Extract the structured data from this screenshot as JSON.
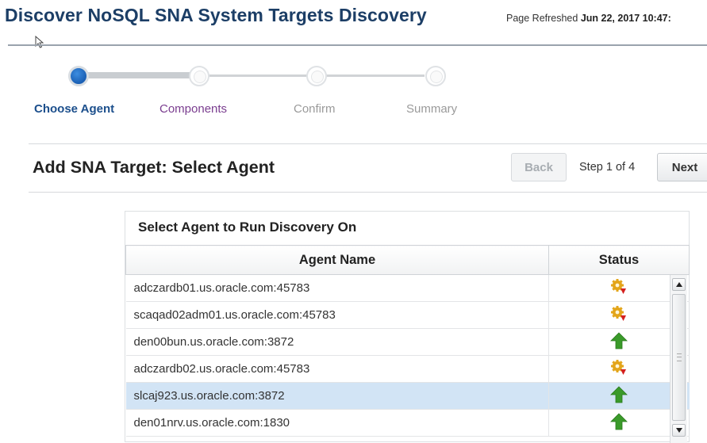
{
  "header": {
    "title": "Discover NoSQL SNA System Targets Discovery",
    "refreshed_label": "Page Refreshed",
    "refreshed_value": "Jun 22, 2017 10:47:"
  },
  "train": {
    "steps": [
      {
        "label": "Choose Agent",
        "state": "current"
      },
      {
        "label": "Components",
        "state": "visited"
      },
      {
        "label": "Confirm",
        "state": "unvisited"
      },
      {
        "label": "Summary",
        "state": "unvisited"
      }
    ]
  },
  "toolbar": {
    "title": "Add SNA Target: Select Agent",
    "back_label": "Back",
    "step_text": "Step 1 of 4",
    "next_label": "Next"
  },
  "agent_panel": {
    "title": "Select Agent to Run Discovery On",
    "columns": [
      "Agent Name",
      "Status"
    ],
    "rows": [
      {
        "name": "adczardb01.us.oracle.com:45783",
        "status": "status-pending-icon"
      },
      {
        "name": "scaqad02adm01.us.oracle.com:45783",
        "status": "status-pending-icon"
      },
      {
        "name": "den00bun.us.oracle.com:3872",
        "status": "status-up-icon"
      },
      {
        "name": "adczardb02.us.oracle.com:45783",
        "status": "status-pending-icon"
      },
      {
        "name": "slcaj923.us.oracle.com:3872",
        "status": "status-up-icon",
        "selected": true
      },
      {
        "name": "den01nrv.us.oracle.com:1830",
        "status": "status-up-icon"
      }
    ]
  },
  "colors": {
    "title_blue": "#1c3e66",
    "current_step": "#1c4f8c",
    "visited_step": "#7a3d8f",
    "selected_row": "#d2e4f5",
    "status_up": "#3a9a2a"
  }
}
